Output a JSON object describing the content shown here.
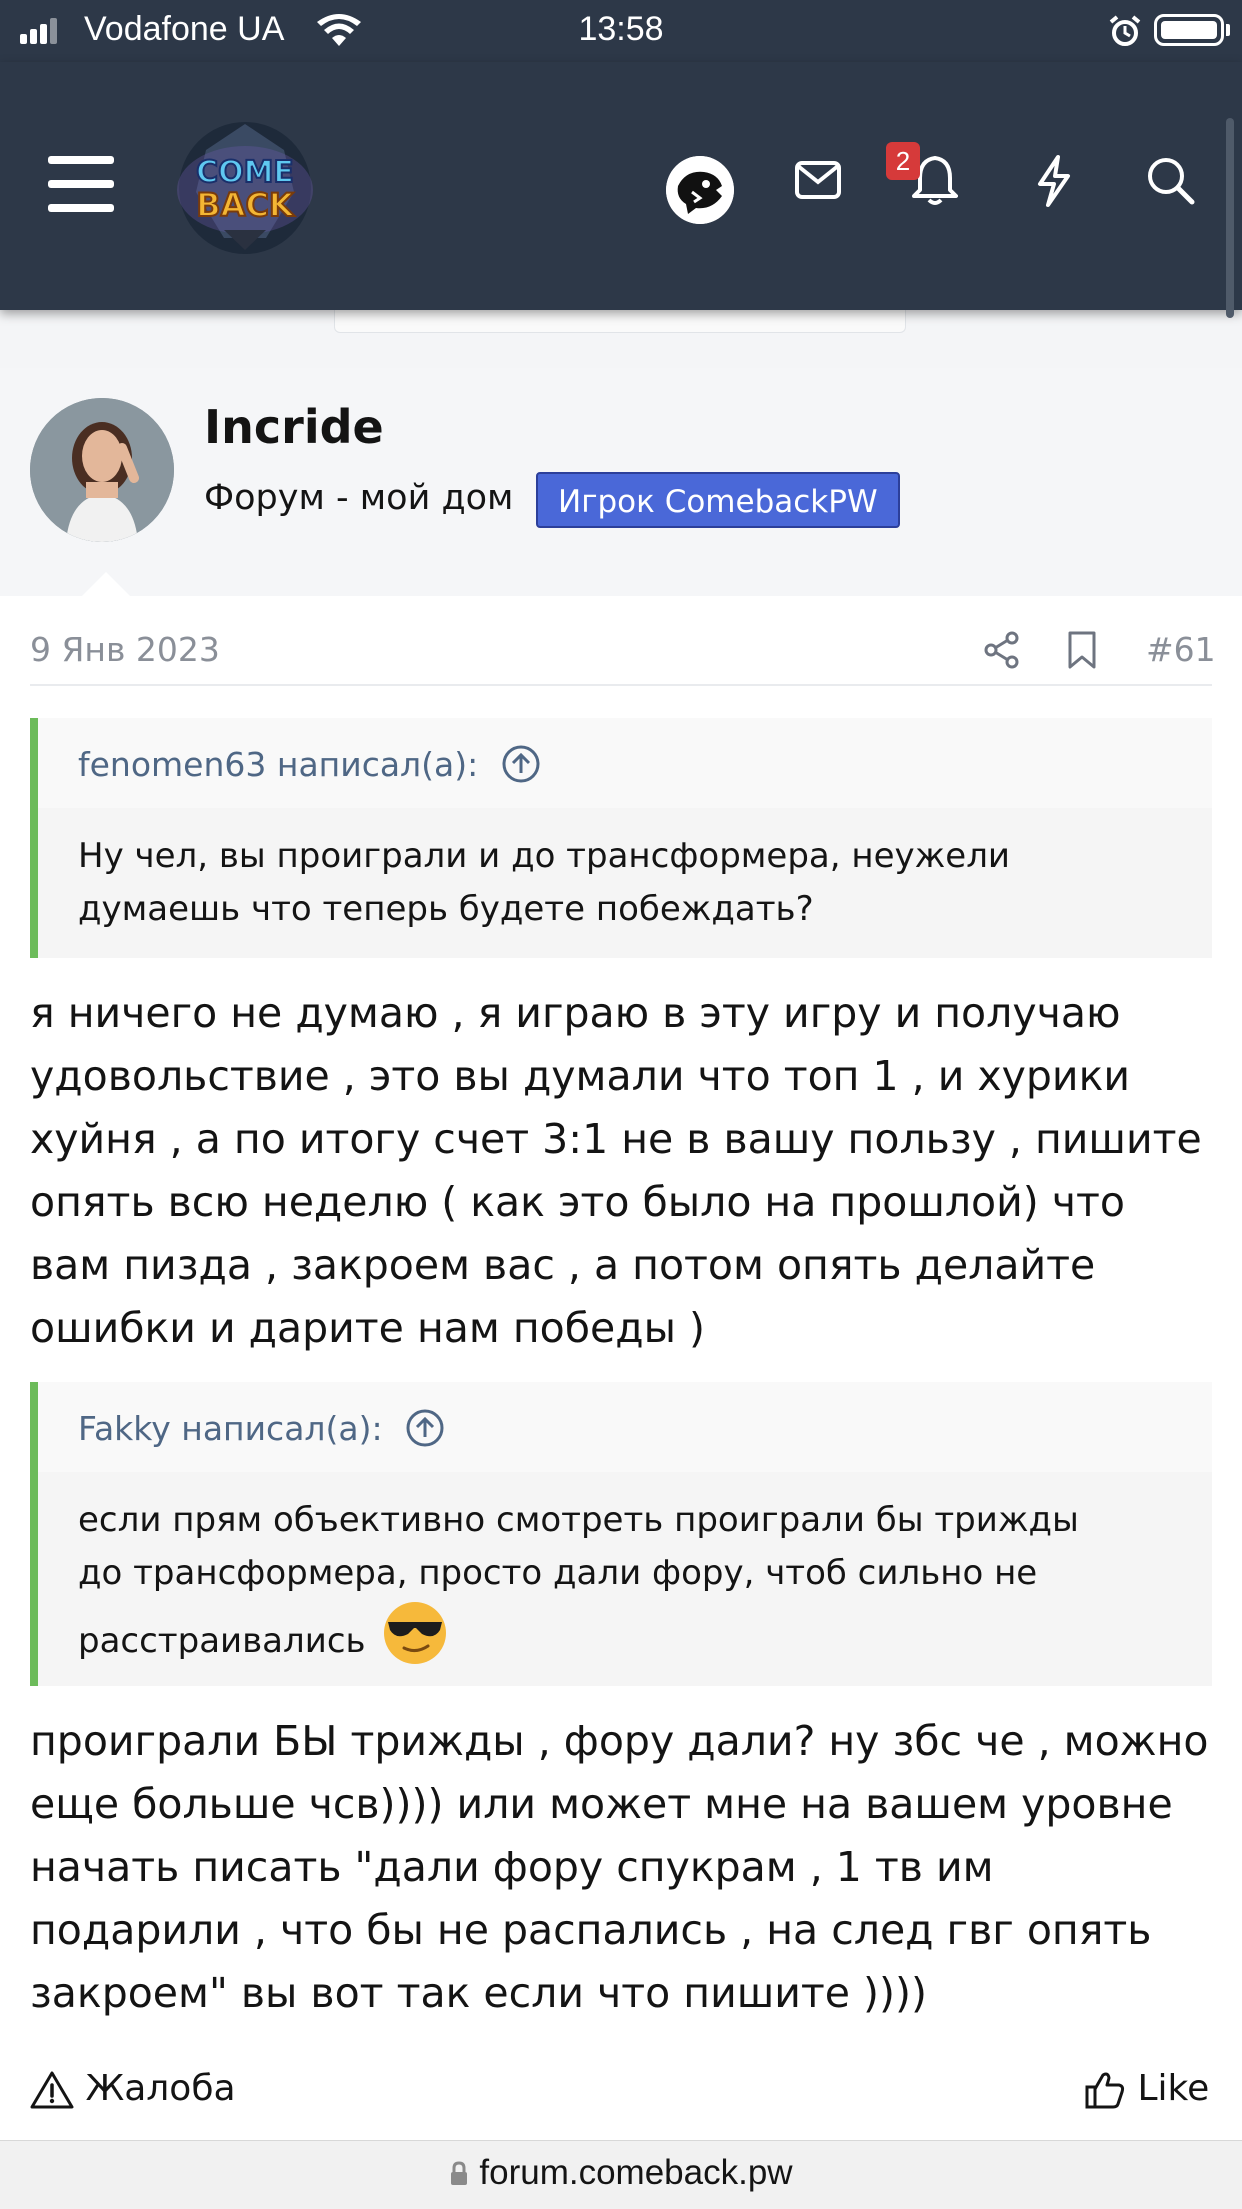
{
  "status_bar": {
    "carrier": "Vodafone UA",
    "time": "13:58"
  },
  "header": {
    "logo_name": "comeback-logo",
    "notification_count": "2",
    "icons": [
      "menu-icon",
      "user-avatar-icon",
      "envelope-icon",
      "bell-icon",
      "lightning-icon",
      "search-icon"
    ]
  },
  "user": {
    "name": "Incride",
    "title": "Форум - мой дом",
    "banner": "Игрок ComebackPW",
    "banner_color": "#4a68d8"
  },
  "post": {
    "date": "9 Янв 2023",
    "number": "#61",
    "quote1": {
      "author": "fenomen63 написал(а):",
      "lines": [
        "Ну чел, вы проиграли и до трансформера, неужели",
        "думаешь что теперь будете побеждать?"
      ]
    },
    "reply1": [
      "я ничего не думаю , я играю в эту игру и получаю",
      "удовольствие , это вы думали что топ 1 , и хурики",
      "хуйня , а по итогу счет 3:1 не в вашу пользу , пишите",
      "опять всю неделю ( как это было на прошлой) что",
      "вам пизда , закроем вас , а потом опять делайте",
      "ошибки и дарите нам победы )"
    ],
    "quote2": {
      "author": "Fakky написал(а):",
      "lines": [
        "если прям объективно смотреть проиграли бы трижды",
        "до трансформера, просто дали фору, чтоб сильно не",
        "расстраивались"
      ],
      "emoji": "sunglasses-emoji"
    },
    "reply2": [
      "проиграли БЫ трижды , фору дали? ну збс че , можно",
      "еще больше чсв)))) или может мне на вашем уровне",
      "начать писать \"дали фору спукрам , 1 тв им",
      "подарили , что бы не распались , на след гвг опять",
      "закроем\" вы вот так если что пишите ))))"
    ]
  },
  "actions": {
    "report": "Жалоба",
    "like": "Like"
  },
  "browser": {
    "url": "forum.comeback.pw"
  }
}
